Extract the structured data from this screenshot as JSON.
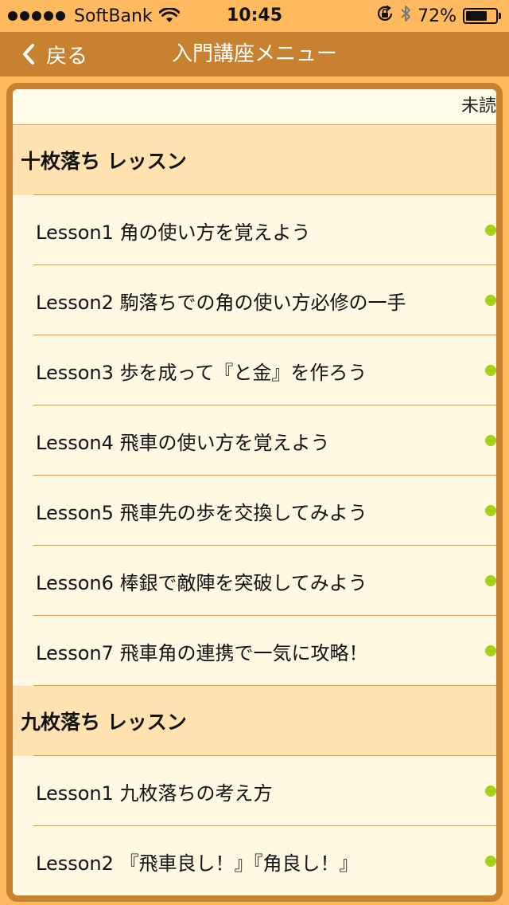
{
  "status_bar": {
    "carrier": "SoftBank",
    "time": "10:45",
    "battery_percent": "72%",
    "battery_level": 0.72,
    "signal_bars": 5
  },
  "nav": {
    "back_label": "戻る",
    "title": "入門講座メニュー"
  },
  "list": {
    "header_label": "未読",
    "sections": [
      {
        "title": "十枚落ち レッスン",
        "lessons": [
          "Lesson1 角の使い方を覚えよう",
          "Lesson2 駒落ちでの角の使い方必修の一手",
          "Lesson3 歩を成って『と金』を作ろう",
          "Lesson4 飛車の使い方を覚えよう",
          "Lesson5 飛車先の歩を交換してみよう",
          "Lesson6 棒銀で敵陣を突破してみよう",
          "Lesson7 飛車角の連携で一気に攻略！"
        ]
      },
      {
        "title": "九枚落ち レッスン",
        "lessons": [
          "Lesson1 九枚落ちの考え方",
          "Lesson2 『飛車良し！』『角良し！』"
        ]
      }
    ]
  },
  "colors": {
    "background": "#FDB95E",
    "nav_bar": "#C8822F",
    "frame": "#C8822F",
    "list_background": "#FFF8E2",
    "section_background": "#FFE2B0",
    "unread_dot": "#A2D01C"
  },
  "icons": {
    "back": "chevron-left-icon",
    "wifi": "wifi-icon",
    "rotation_lock": "rotation-lock-icon",
    "bluetooth": "bluetooth-icon",
    "battery": "battery-icon",
    "unread": "unread-dot-icon"
  }
}
